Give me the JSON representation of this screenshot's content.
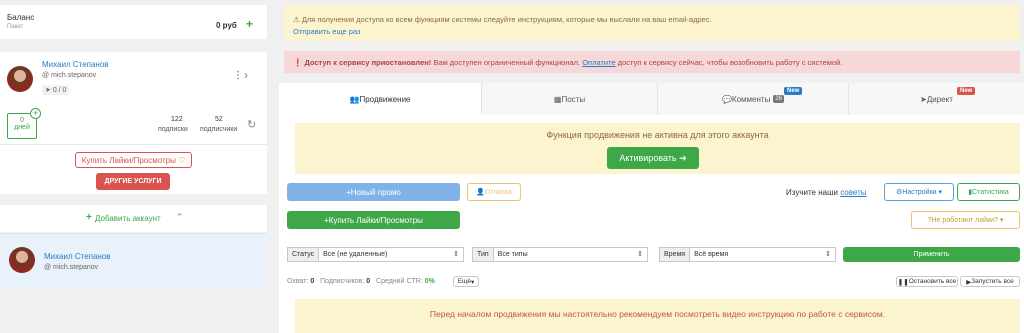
{
  "balance": {
    "label": "Баланс",
    "sublabel": "Пакет",
    "value": "0 руб"
  },
  "account": {
    "name": "Михаил Степанов",
    "username": "@ mich.stepanov",
    "stats_badge": "0 / 0",
    "days_value": "0",
    "days_label": "дней",
    "subscriptions_value": "122",
    "subscriptions_label": "подписки",
    "subscribers_value": "52",
    "subscribers_label": "подписчики"
  },
  "buttons": {
    "buy_likes": "Купить Лайки/Просмотры",
    "other_services": "ДРУГИЕ УСЛУГИ",
    "add_account": "Добавить аккаунт"
  },
  "account_list": [
    {
      "name": "Михаил Степанов",
      "username": "@ mich.stepanov"
    }
  ],
  "alerts": {
    "info_text": "Для получения доступа ко всем функциям системы следуйте инструкциям, которые мы выслали на ваш email-адрес.",
    "info_link": "Отправить еще раз",
    "danger_bold": "Доступ к сервису приостановлен!",
    "danger_text": "Вам доступен ограниченный функционал.",
    "danger_link": "Оплатите",
    "danger_text2": "доступ к сервису сейчас, чтобы возобновить работу с системой."
  },
  "tabs": [
    {
      "label": "Продвижение",
      "icon": "users-icon"
    },
    {
      "label": "Посты",
      "icon": "grid-icon"
    },
    {
      "label": "Комменты",
      "icon": "comments-icon",
      "count": "26",
      "badge": "New"
    },
    {
      "label": "Директ",
      "icon": "send-icon",
      "badge": "New"
    }
  ],
  "promo_banner": {
    "title": "Функция продвижения не активна для этого аккаунта",
    "button": "Активировать"
  },
  "toolbar": {
    "new_promo": "Новый промо",
    "unsubscribe": "Отписка",
    "buy_likes": "Купить Лайки/Просмотры",
    "study_text": "Изучите наши",
    "study_link": "советы",
    "settings": "Настройки",
    "statistics": "Статистика",
    "not_working": "Не работают лайки?"
  },
  "filters": {
    "status_label": "Статус",
    "status_value": "Все (не удаленные)",
    "type_label": "Тип",
    "type_value": "Все типы",
    "time_label": "Время",
    "time_value": "Всё время",
    "apply": "Применить"
  },
  "summary": {
    "reach_label": "Охват:",
    "reach_value": "0",
    "subs_label": "Подписчиков:",
    "subs_value": "0",
    "ctr_label": "Средний CTR:",
    "ctr_value": "0%",
    "more": "Ещё",
    "stop_all": "Остановить все",
    "start_all": "Запустить все"
  },
  "bottom_notice": "Перед началом продвижения мы настоятельно рекомендуем посмотреть видео инструкцию по работе с сервисом.",
  "colors": {
    "green": "#3ea849",
    "blue": "#5a9fe0",
    "red": "#d9534f",
    "link": "#2a7bbf",
    "warning_bg": "#fcf3cf",
    "danger_bg": "#f6d8d8"
  }
}
